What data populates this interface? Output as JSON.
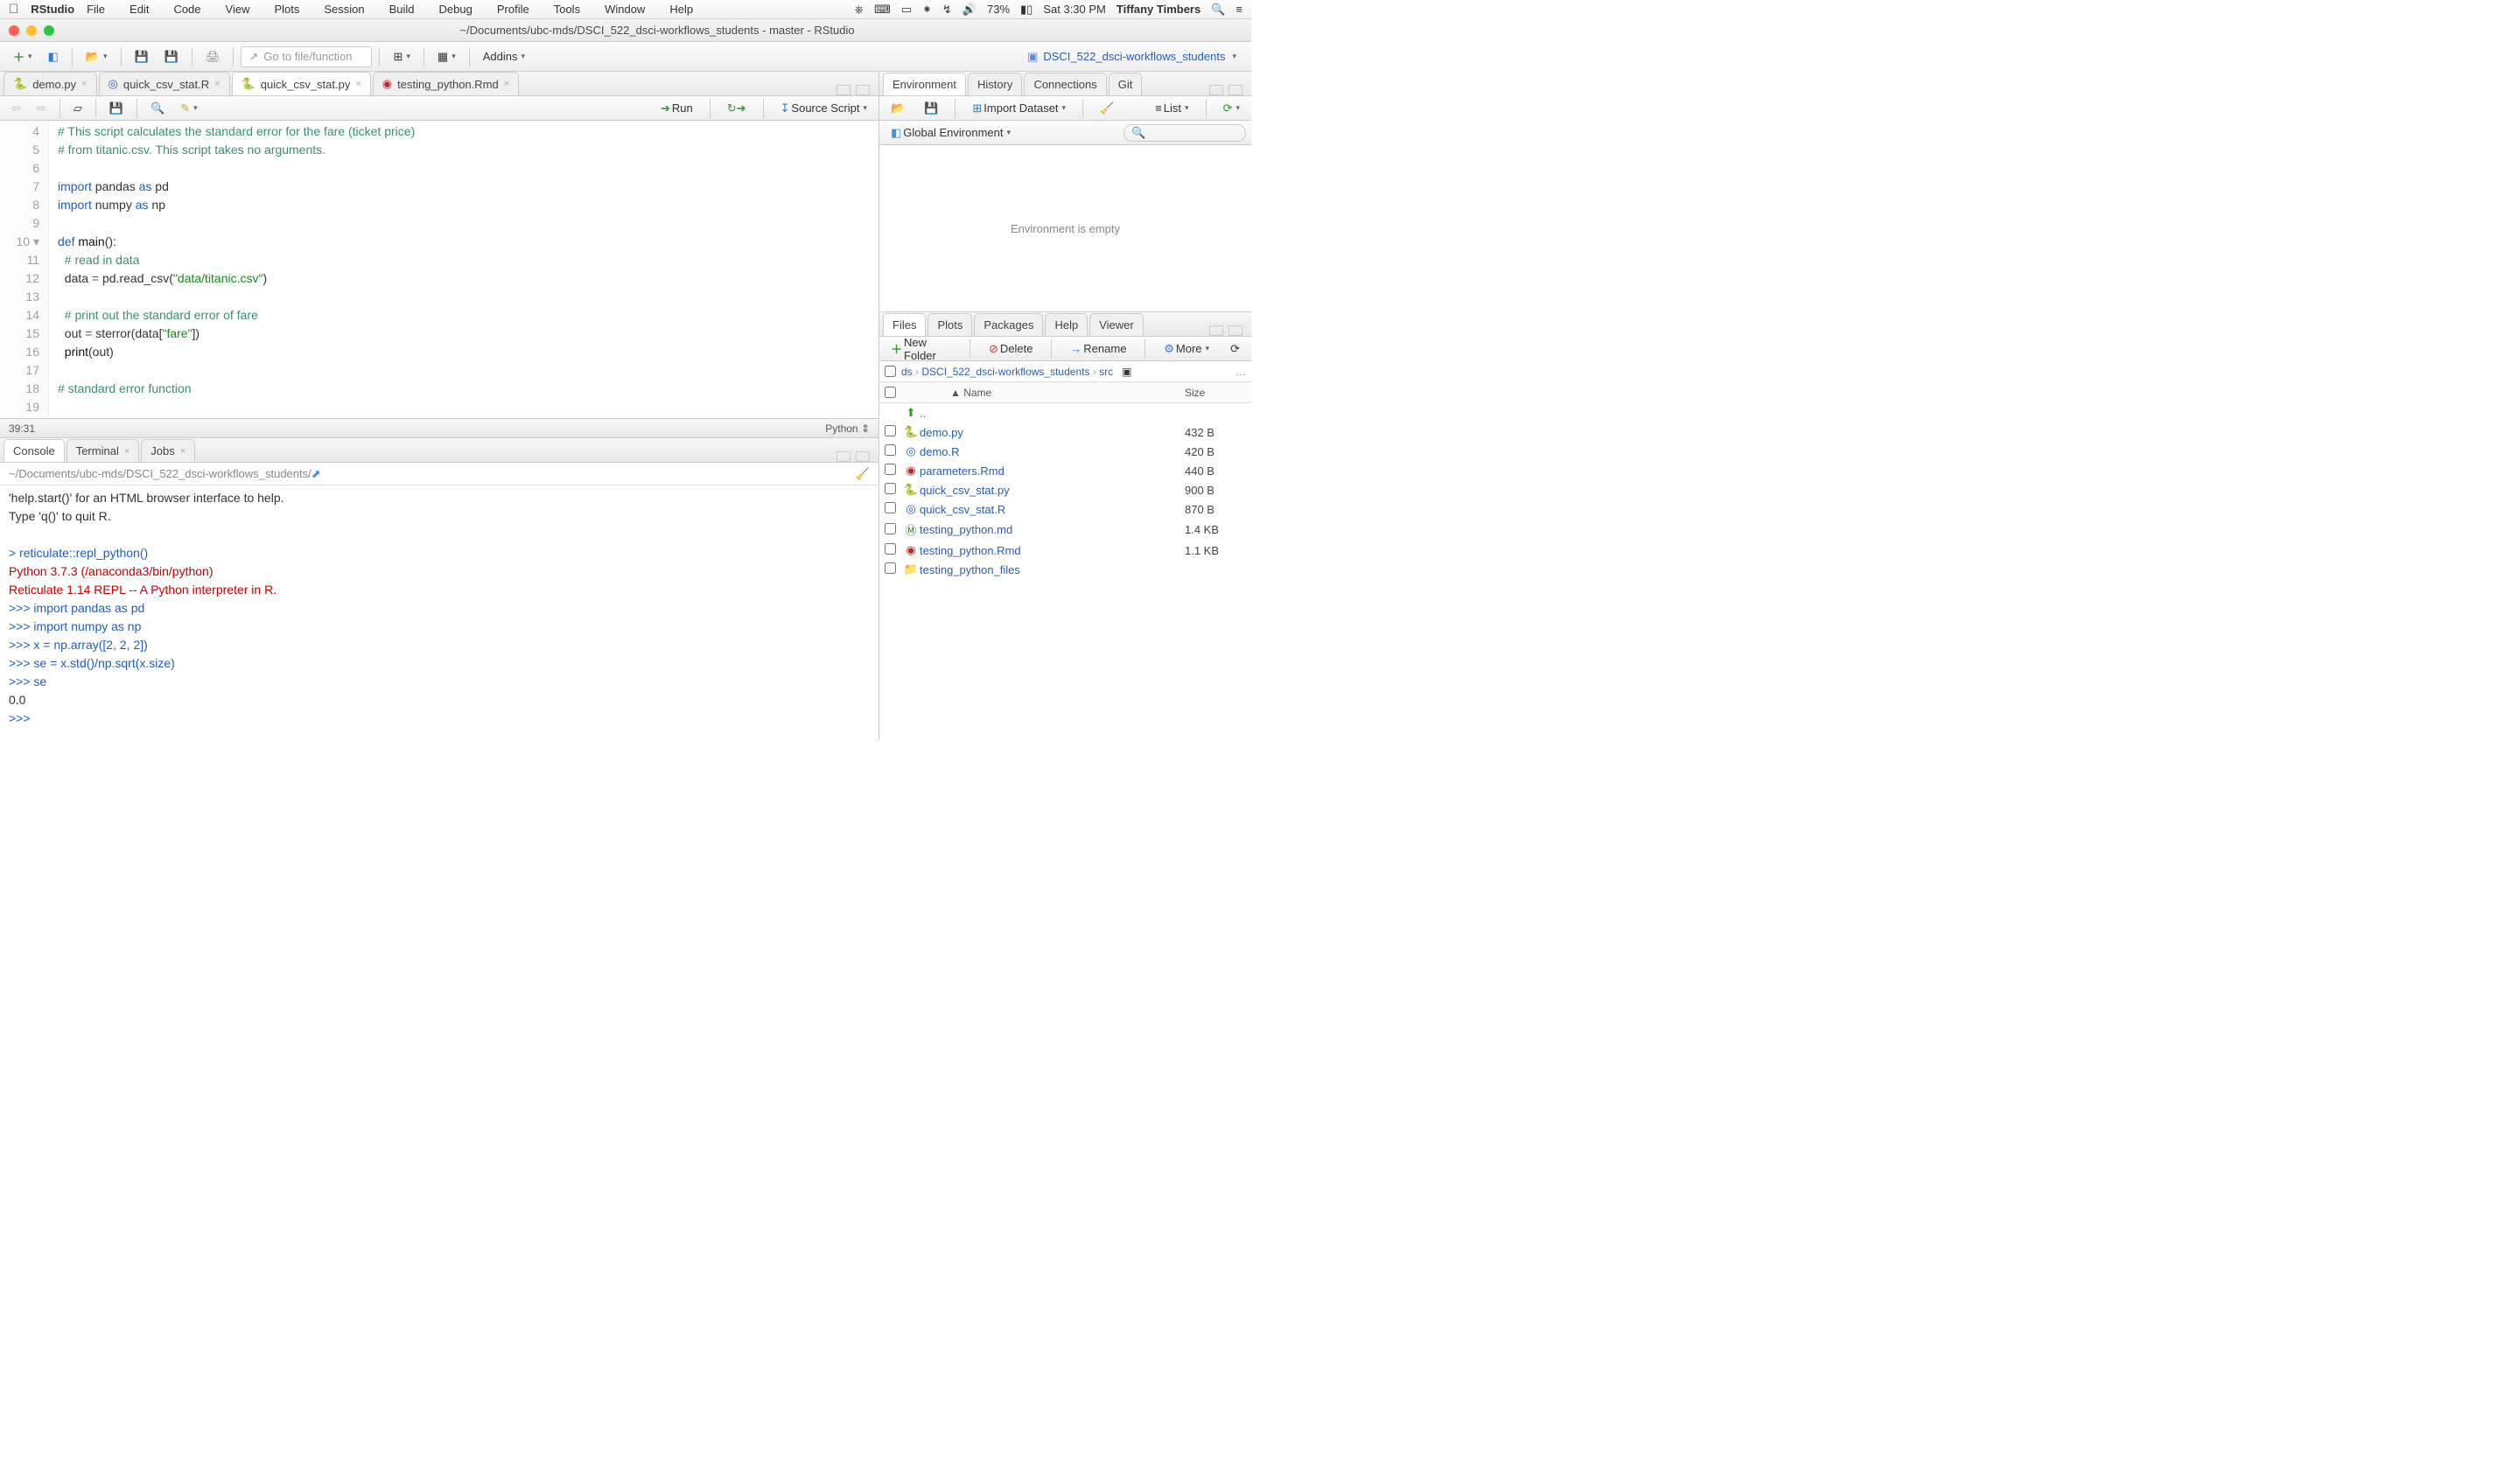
{
  "mac_menu": {
    "appname": "RStudio",
    "items": [
      "File",
      "Edit",
      "Code",
      "View",
      "Plots",
      "Session",
      "Build",
      "Debug",
      "Profile",
      "Tools",
      "Window",
      "Help"
    ],
    "battery": "73%",
    "clock": "Sat 3:30 PM",
    "user": "Tiffany Timbers"
  },
  "window_title": "~/Documents/ubc-mds/DSCI_522_dsci-workflows_students - master - RStudio",
  "main_toolbar": {
    "goto_placeholder": "Go to file/function",
    "addins": "Addins",
    "project_name": "DSCI_522_dsci-workflows_students"
  },
  "source": {
    "tabs": [
      {
        "label": "demo.py",
        "icon": "py"
      },
      {
        "label": "quick_csv_stat.R",
        "icon": "r"
      },
      {
        "label": "quick_csv_stat.py",
        "icon": "py",
        "active": true
      },
      {
        "label": "testing_python.Rmd",
        "icon": "rmd"
      }
    ],
    "toolbar": {
      "run": "Run",
      "source": "Source Script"
    },
    "lines": [
      {
        "n": 4,
        "html": "<span class='c-cmt'># This script calculates the standard error for the fare (ticket price)</span>"
      },
      {
        "n": 5,
        "html": "<span class='c-cmt'># from titanic.csv. This script takes no arguments.</span>"
      },
      {
        "n": 6,
        "html": ""
      },
      {
        "n": 7,
        "html": "<span class='c-kw'>import</span> pandas <span class='c-kw'>as</span> pd"
      },
      {
        "n": 8,
        "html": "<span class='c-kw'>import</span> numpy <span class='c-kw'>as</span> np"
      },
      {
        "n": 9,
        "html": ""
      },
      {
        "n": 10,
        "fold": true,
        "html": "<span class='c-kw'>def</span> <span class='c-fn'>main</span>():"
      },
      {
        "n": 11,
        "html": "  <span class='c-cmt'># read in data</span>"
      },
      {
        "n": 12,
        "html": "  data <span class='c-op'>=</span> pd.read_csv(<span class='c-str'>\"data/titanic.csv\"</span>)"
      },
      {
        "n": 13,
        "html": ""
      },
      {
        "n": 14,
        "html": "  <span class='c-cmt'># print out the standard error of fare</span>"
      },
      {
        "n": 15,
        "html": "  out <span class='c-op'>=</span> sterror(data[<span class='c-str'>\"fare\"</span>])"
      },
      {
        "n": 16,
        "html": "  <span class='c-fn'>print</span>(out)"
      },
      {
        "n": 17,
        "html": ""
      },
      {
        "n": 18,
        "html": "<span class='c-cmt'># standard error function</span>"
      },
      {
        "n": 19,
        "html": ""
      }
    ],
    "status_pos": "39:31",
    "status_lang": "Python"
  },
  "console": {
    "tabs": [
      "Console",
      "Terminal",
      "Jobs"
    ],
    "path": "~/Documents/ubc-mds/DSCI_522_dsci-workflows_students/",
    "lines": [
      {
        "cls": "",
        "text": "'help.start()' for an HTML browser interface to help."
      },
      {
        "cls": "",
        "text": "Type 'q()' to quit R."
      },
      {
        "cls": "",
        "text": ""
      },
      {
        "cls": "con-blue",
        "text": "> reticulate::repl_python()"
      },
      {
        "cls": "con-red",
        "text": "Python 3.7.3 (/anaconda3/bin/python)"
      },
      {
        "cls": "con-red",
        "text": "Reticulate 1.14 REPL -- A Python interpreter in R."
      },
      {
        "cls": "con-blue",
        "text": ">>> import pandas as pd"
      },
      {
        "cls": "con-blue",
        "text": ">>> import numpy as np"
      },
      {
        "cls": "con-blue",
        "text": ">>> x = np.array([2, 2, 2])"
      },
      {
        "cls": "con-blue",
        "text": ">>> se = x.std()/np.sqrt(x.size)"
      },
      {
        "cls": "con-blue",
        "text": ">>> se"
      },
      {
        "cls": "",
        "text": "0.0"
      },
      {
        "cls": "con-blue",
        "text": ">>> "
      }
    ]
  },
  "env": {
    "tabs": [
      "Environment",
      "History",
      "Connections",
      "Git"
    ],
    "import": "Import Dataset",
    "list": "List",
    "scope": "Global Environment",
    "empty": "Environment is empty"
  },
  "files": {
    "tabs": [
      "Files",
      "Plots",
      "Packages",
      "Help",
      "Viewer"
    ],
    "buttons": {
      "newfolder": "New Folder",
      "delete": "Delete",
      "rename": "Rename",
      "more": "More"
    },
    "breadcrumb": [
      "ds",
      "DSCI_522_dsci-workflows_students",
      "src"
    ],
    "header": {
      "name": "Name",
      "size": "Size"
    },
    "up": "..",
    "rows": [
      {
        "name": "demo.py",
        "size": "432 B",
        "icon": "py"
      },
      {
        "name": "demo.R",
        "size": "420 B",
        "icon": "r"
      },
      {
        "name": "parameters.Rmd",
        "size": "440 B",
        "icon": "rmd"
      },
      {
        "name": "quick_csv_stat.py",
        "size": "900 B",
        "icon": "py"
      },
      {
        "name": "quick_csv_stat.R",
        "size": "870 B",
        "icon": "r"
      },
      {
        "name": "testing_python.md",
        "size": "1.4 KB",
        "icon": "md"
      },
      {
        "name": "testing_python.Rmd",
        "size": "1.1 KB",
        "icon": "rmd"
      },
      {
        "name": "testing_python_files",
        "size": "",
        "icon": "folder"
      }
    ]
  }
}
